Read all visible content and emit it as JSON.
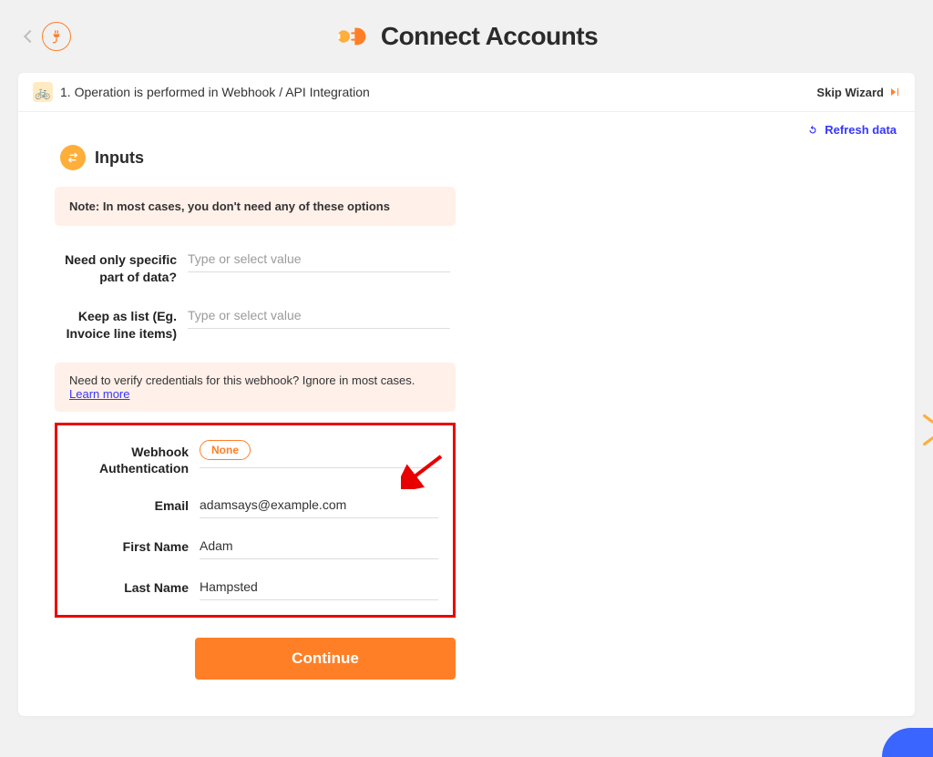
{
  "header": {
    "title": "Connect Accounts"
  },
  "card": {
    "breadcrumb_icon": "🚲",
    "breadcrumb": "1. Operation is performed in Webhook / API Integration",
    "skip_label": "Skip Wizard",
    "refresh_label": "Refresh data"
  },
  "section": {
    "title": "Inputs"
  },
  "notes": {
    "top": "Note: In most cases, you don't need any of these options",
    "verify": "Need to verify credentials for this webhook? Ignore in most cases.",
    "learn_more": "Learn more"
  },
  "fields": {
    "specific": {
      "label": "Need only specific part of data?",
      "placeholder": "Type or select value",
      "value": ""
    },
    "keep_list": {
      "label": "Keep as list (Eg. Invoice line items)",
      "placeholder": "Type or select value",
      "value": ""
    },
    "auth": {
      "label": "Webhook Authentication",
      "value": "None"
    },
    "email": {
      "label": "Email",
      "value": "adamsays@example.com"
    },
    "first_name": {
      "label": "First Name",
      "value": "Adam"
    },
    "last_name": {
      "label": "Last Name",
      "value": "Hampsted"
    }
  },
  "buttons": {
    "continue": "Continue"
  }
}
